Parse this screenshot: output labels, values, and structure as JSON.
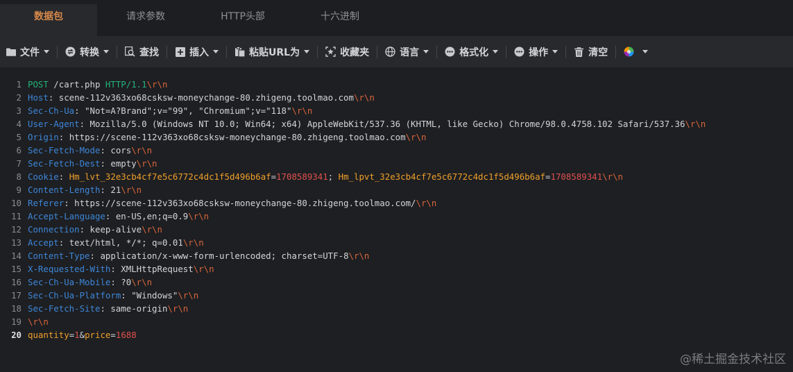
{
  "tabs": [
    {
      "label": "数据包",
      "active": true
    },
    {
      "label": "请求参数",
      "active": false
    },
    {
      "label": "HTTP头部",
      "active": false
    },
    {
      "label": "十六进制",
      "active": false
    }
  ],
  "toolbar": {
    "file": "文件",
    "convert": "转换",
    "find": "查找",
    "insert": "插入",
    "paste_url": "粘贴URL为",
    "favorites": "收藏夹",
    "language": "语言",
    "format": "格式化",
    "action": "操作",
    "clear": "清空"
  },
  "request": {
    "method": "POST",
    "path": " /cart.php ",
    "version": "HTTP/1.1",
    "crlf": "\\r\\n",
    "headers": [
      {
        "name": "Host",
        "value": "scene-112v363xo68csksw-moneychange-80.zhigeng.toolmao.com"
      },
      {
        "name": "Sec-Ch-Ua",
        "value": "\"Not=A?Brand\";v=\"99\", \"Chromium\";v=\"118\""
      },
      {
        "name": "User-Agent",
        "value": "Mozilla/5.0 (Windows NT 10.0; Win64; x64) AppleWebKit/537.36 (KHTML, like Gecko) Chrome/98.0.4758.102 Safari/537.36"
      },
      {
        "name": "Origin",
        "value": "https://scene-112v363xo68csksw-moneychange-80.zhigeng.toolmao.com"
      },
      {
        "name": "Sec-Fetch-Mode",
        "value": "cors"
      },
      {
        "name": "Sec-Fetch-Dest",
        "value": "empty"
      },
      {
        "name": "Cookie",
        "value": ""
      },
      {
        "name": "Content-Length",
        "value": "21"
      },
      {
        "name": "Referer",
        "value": "https://scene-112v363xo68csksw-moneychange-80.zhigeng.toolmao.com/"
      },
      {
        "name": "Accept-Language",
        "value": "en-US,en;q=0.9"
      },
      {
        "name": "Connection",
        "value": "keep-alive"
      },
      {
        "name": "Accept",
        "value": "text/html, */*; q=0.01"
      },
      {
        "name": "Content-Type",
        "value": "application/x-www-form-urlencoded; charset=UTF-8"
      },
      {
        "name": "X-Requested-With",
        "value": "XMLHttpRequest"
      },
      {
        "name": "Sec-Ch-Ua-Mobile",
        "value": "?0"
      },
      {
        "name": "Sec-Ch-Ua-Platform",
        "value": "\"Windows\""
      },
      {
        "name": "Sec-Fetch-Site",
        "value": "same-origin"
      }
    ],
    "cookies": [
      {
        "key": "Hm_lvt_32e3cb4cf7e5c6772c4dc1f5d496b6af",
        "value": "1708589341"
      },
      {
        "key": "Hm_lpvt_32e3cb4cf7e5c6772c4dc1f5d496b6af",
        "value": "1708589341"
      }
    ],
    "body": [
      {
        "key": "quantity",
        "value": "1"
      },
      {
        "key": "price",
        "value": "1688"
      }
    ]
  },
  "line_numbers": [
    "1",
    "2",
    "3",
    "4",
    "5",
    "6",
    "7",
    "8",
    "9",
    "10",
    "11",
    "12",
    "13",
    "14",
    "15",
    "16",
    "17",
    "18",
    "19",
    "20"
  ],
  "watermark": "@稀土掘金技术社区",
  "colors": {
    "accent": "#d7894a",
    "method": "#22b57a",
    "header_key": "#3d86d8",
    "crlf": "#d9663c",
    "param_key": "#f0a02a",
    "param_value": "#e0504f"
  }
}
